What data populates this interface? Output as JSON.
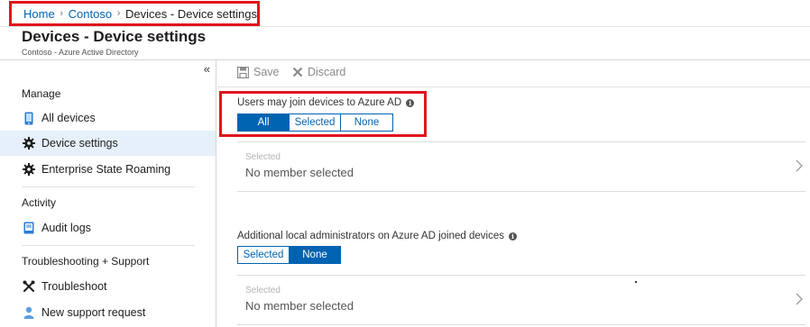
{
  "breadcrumb": {
    "home": "Home",
    "tenant": "Contoso",
    "current": "Devices - Device settings"
  },
  "header": {
    "title": "Devices - Device settings",
    "subtitle": "Contoso - Azure Active Directory"
  },
  "sidebar": {
    "collapse_glyph": "«",
    "sections": [
      {
        "title": "Manage",
        "items": [
          {
            "label": "All devices",
            "icon": "device-icon"
          },
          {
            "label": "Device settings",
            "icon": "gear-icon",
            "active": true
          },
          {
            "label": "Enterprise State Roaming",
            "icon": "gear-icon"
          }
        ]
      },
      {
        "title": "Activity",
        "items": [
          {
            "label": "Audit logs",
            "icon": "book-icon"
          }
        ]
      },
      {
        "title": "Troubleshooting + Support",
        "items": [
          {
            "label": "Troubleshoot",
            "icon": "wrench-icon"
          },
          {
            "label": "New support request",
            "icon": "support-person-icon"
          }
        ]
      }
    ]
  },
  "toolbar": {
    "save_label": "Save",
    "discard_label": "Discard"
  },
  "settings": {
    "join_devices": {
      "label": "Users may join devices to Azure AD",
      "options": [
        "All",
        "Selected",
        "None"
      ],
      "selected": "All",
      "picker_label": "Selected",
      "picker_value": "No member selected"
    },
    "local_admins": {
      "label": "Additional local administrators on Azure AD joined devices",
      "options": [
        "Selected",
        "None"
      ],
      "selected": "None",
      "picker_label": "Selected",
      "picker_value": "No member selected"
    }
  },
  "colors": {
    "accent": "#0063b1",
    "highlight": "#e1141d",
    "active_nav_bg": "#e6f0fa"
  }
}
